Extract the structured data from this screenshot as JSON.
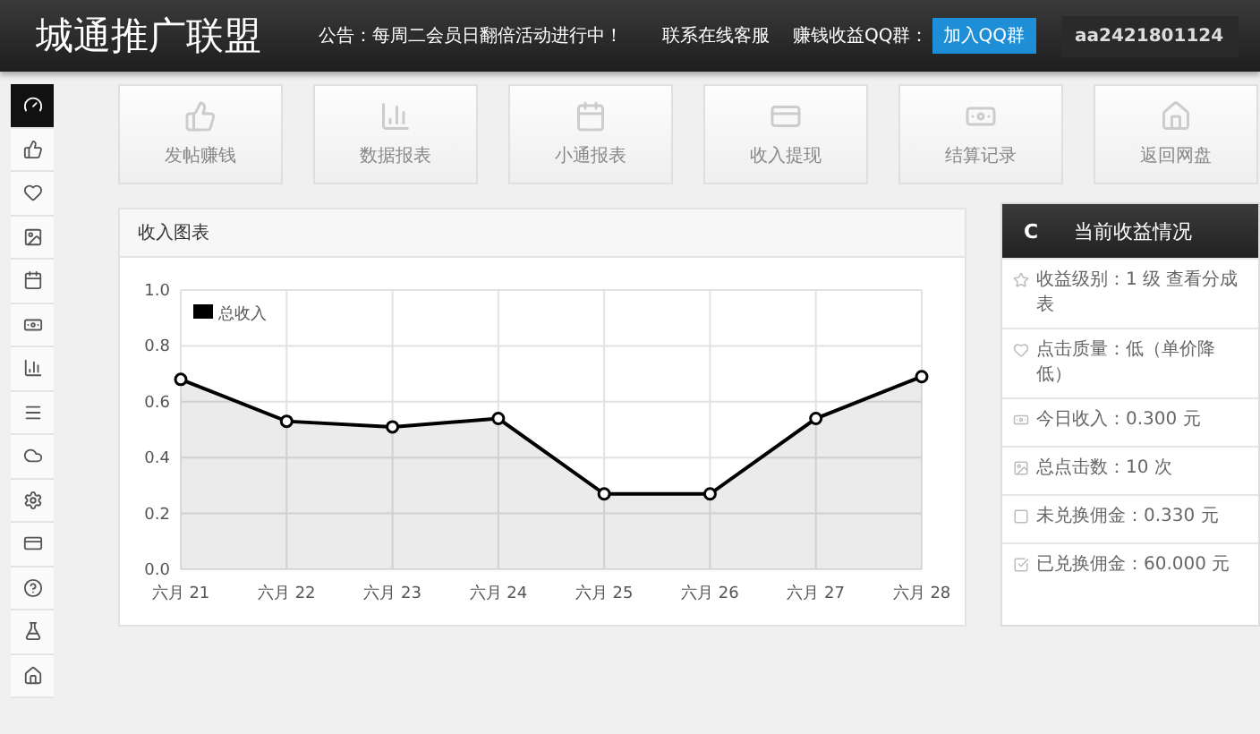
{
  "header": {
    "title": "城通推广联盟",
    "notice": "公告：每周二会员日翻倍活动进行中！",
    "service_link": "联系在线客服",
    "qq_label": "赚钱收益QQ群：",
    "qq_button": "加入QQ群",
    "username": "aa2421801124"
  },
  "sidebar": {
    "items": [
      {
        "selected": true
      },
      {
        "selected": false
      },
      {
        "selected": false
      },
      {
        "selected": false
      },
      {
        "selected": false
      },
      {
        "selected": false
      },
      {
        "selected": false
      },
      {
        "selected": false
      },
      {
        "selected": false
      },
      {
        "selected": false
      },
      {
        "selected": false
      },
      {
        "selected": false
      },
      {
        "selected": false
      },
      {
        "selected": false
      }
    ]
  },
  "tiles": [
    {
      "label": "发帖赚钱"
    },
    {
      "label": "数据报表"
    },
    {
      "label": "小通报表"
    },
    {
      "label": "收入提现"
    },
    {
      "label": "结算记录"
    },
    {
      "label": "返回网盘"
    }
  ],
  "chart_panel": {
    "title": "收入图表",
    "chart_data": {
      "type": "area",
      "categories": [
        "六月 21",
        "六月 22",
        "六月 23",
        "六月 24",
        "六月 25",
        "六月 26",
        "六月 27",
        "六月 28"
      ],
      "series": [
        {
          "name": "总收入",
          "color": "#000000",
          "values": [
            0.68,
            0.53,
            0.51,
            0.54,
            0.27,
            0.27,
            0.54,
            0.69
          ]
        }
      ],
      "grid": true,
      "ylim": [
        0,
        1
      ],
      "yticks": [
        {
          "value": 0,
          "label": "0.0"
        },
        {
          "value": 0.2,
          "label": "0.2"
        },
        {
          "value": 0.4,
          "label": "0.4"
        },
        {
          "value": 0.6,
          "label": "0.6"
        },
        {
          "value": 0.8,
          "label": "0.8"
        },
        {
          "value": 1,
          "label": "1.0"
        }
      ]
    }
  },
  "stats_panel": {
    "refresh_icon": "C",
    "title": "当前收益情况",
    "items": [
      {
        "text": "收益级别：1 级 查看分成表"
      },
      {
        "text": "点击质量：低（单价降低）"
      },
      {
        "text": "今日收入：0.300 元"
      },
      {
        "text": "总点击数：10 次"
      },
      {
        "text": "未兑换佣金：0.330 元"
      },
      {
        "text": "已兑换佣金：60.000 元"
      }
    ]
  }
}
